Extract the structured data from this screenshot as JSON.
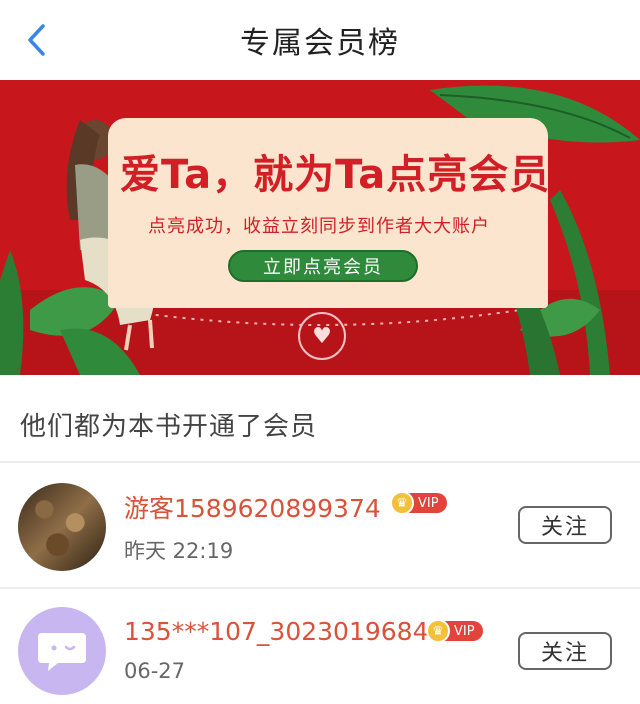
{
  "header": {
    "title": "专属会员榜"
  },
  "banner": {
    "headline": "爱Ta，就为Ta点亮会员",
    "subline": "点亮成功，收益立刻同步到作者大大账户",
    "cta_label": "立即点亮会员"
  },
  "section": {
    "title": "他们都为本书开通了会员"
  },
  "members": [
    {
      "name": "游客1589620899374",
      "badge": "VIP",
      "time": "昨天 22:19",
      "follow_label": "关注"
    },
    {
      "name": "135***107_3023019684",
      "badge": "VIP",
      "time": "06-27",
      "follow_label": "关注"
    }
  ],
  "colors": {
    "accent": "#d8533a",
    "banner_red": "#c8161d",
    "back_blue": "#3a86e8"
  }
}
